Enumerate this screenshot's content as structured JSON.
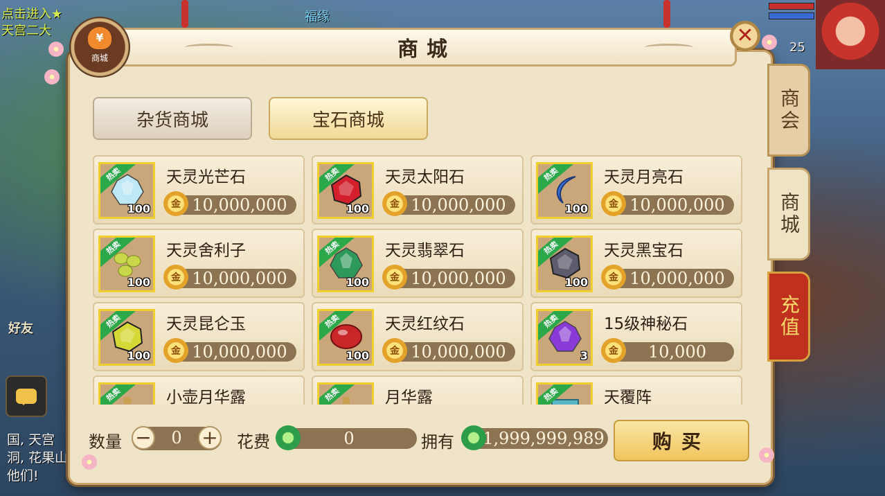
{
  "background": {
    "top_left_lines": [
      "点击进入★",
      "天宫二大"
    ],
    "top_center": "福缘",
    "friends_label": "好友",
    "chat_lines": [
      "国, 天宫",
      "洞, 花果山",
      "他们!"
    ],
    "player_level": "25"
  },
  "shop": {
    "badge_label": "商城",
    "title": "商城",
    "close_icon": "close-icon",
    "tabs": [
      {
        "label": "杂货商城",
        "active": false
      },
      {
        "label": "宝石商城",
        "active": true
      }
    ],
    "side_tabs": [
      {
        "label": "商会"
      },
      {
        "label": "商城"
      },
      {
        "label": "充值"
      }
    ],
    "hot_tag": "热卖",
    "items": [
      {
        "name": "天灵光芒石",
        "qty": "100",
        "price": "10,000,000",
        "gem_color": "#bfe8f6",
        "gem_shape": "crystal"
      },
      {
        "name": "天灵太阳石",
        "qty": "100",
        "price": "10,000,000",
        "gem_color": "#d3202c",
        "gem_shape": "round"
      },
      {
        "name": "天灵月亮石",
        "qty": "100",
        "price": "10,000,000",
        "gem_color": "#3a6fd6",
        "gem_shape": "crescent"
      },
      {
        "name": "天灵舍利子",
        "qty": "100",
        "price": "10,000,000",
        "gem_color": "#c8d84a",
        "gem_shape": "pearls"
      },
      {
        "name": "天灵翡翠石",
        "qty": "100",
        "price": "10,000,000",
        "gem_color": "#2e9a5a",
        "gem_shape": "crystal"
      },
      {
        "name": "天灵黑宝石",
        "qty": "100",
        "price": "10,000,000",
        "gem_color": "#5c5c6e",
        "gem_shape": "round"
      },
      {
        "name": "天灵昆仑玉",
        "qty": "100",
        "price": "10,000,000",
        "gem_color": "#d6d836",
        "gem_shape": "round"
      },
      {
        "name": "天灵红纹石",
        "qty": "100",
        "price": "10,000,000",
        "gem_color": "#c9262a",
        "gem_shape": "oval"
      },
      {
        "name": "15级神秘石",
        "qty": "3",
        "price": "10,000",
        "gem_color": "#8a3ad6",
        "gem_shape": "crystal"
      },
      {
        "name": "小壶月华露",
        "qty": "",
        "price": "",
        "gem_color": "#e8c040",
        "gem_shape": "bottle"
      },
      {
        "name": "月华露",
        "qty": "",
        "price": "",
        "gem_color": "#e8c040",
        "gem_shape": "bottle"
      },
      {
        "name": "天覆阵",
        "qty": "",
        "price": "",
        "gem_color": "#58b6c8",
        "gem_shape": "scroll"
      }
    ],
    "bottom": {
      "qty_label": "数量",
      "qty_value": "0",
      "minus": "−",
      "plus": "+",
      "cost_label": "花费",
      "cost_value": "0",
      "own_label": "拥有",
      "own_value": "1,999,999,989",
      "buy_label": "购买"
    }
  }
}
